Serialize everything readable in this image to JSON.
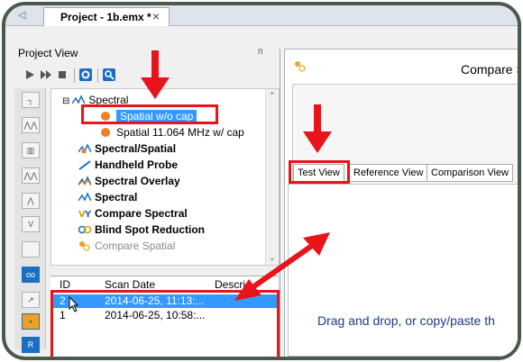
{
  "document_tab": {
    "scroll_glyph": "◁",
    "label": "Project - 1b.emx *",
    "close_glyph": "×"
  },
  "project_view": {
    "title": "Project View",
    "pin_glyph": "ᴨ",
    "toolbar": [
      "play-icon",
      "fast-forward-icon",
      "stop-icon",
      "settings-icon",
      "search-icon"
    ],
    "left_rail_icons": [
      "spectral-icon",
      "spectral-icon",
      "bars-icon",
      "spectral-icon",
      "spectral-icon",
      "compare-icon",
      "blank-icon",
      "blind-spot-icon",
      "probe-icon",
      "overlay-icon",
      "app-icon"
    ],
    "tree": [
      {
        "label": "Spectral",
        "level": 1,
        "icon": "spectral-icon",
        "expanded": true
      },
      {
        "label": "Spatial w/o cap",
        "level": 2,
        "icon": "spatial-dot-icon",
        "selected": true
      },
      {
        "label": "Spatial 11.064 MHz w/ cap",
        "level": 2,
        "icon": "spatial-dot-icon"
      },
      {
        "label": "Spectral/Spatial",
        "level": 1,
        "icon": "spectral-spatial-icon"
      },
      {
        "label": "Handheld Probe",
        "level": 1,
        "icon": "probe-icon"
      },
      {
        "label": "Spectral Overlay",
        "level": 1,
        "icon": "overlay-icon"
      },
      {
        "label": "Spectral",
        "level": 1,
        "icon": "spectral-icon"
      },
      {
        "label": "Compare Spectral",
        "level": 1,
        "icon": "compare-spectral-icon"
      },
      {
        "label": "Blind Spot Reduction",
        "level": 1,
        "icon": "blind-spot-icon"
      },
      {
        "label": "Compare Spatial",
        "level": 1,
        "icon": "compare-spatial-icon",
        "disabled": true
      }
    ],
    "grid": {
      "columns": [
        "ID",
        "Scan Date",
        "Descri"
      ],
      "rows": [
        {
          "id": "2",
          "date": "2014-06-25,  11:13:...",
          "desc": "",
          "selected": true
        },
        {
          "id": "1",
          "date": "2014-06-25,  10:58:...",
          "desc": "",
          "selected": false
        }
      ]
    }
  },
  "compare_panel": {
    "title": "Compare S",
    "tabs": [
      "Test View",
      "Reference View",
      "Comparison View"
    ],
    "active_tab": "Test View",
    "drag_text": "Drag and drop, or copy/paste th"
  },
  "colors": {
    "highlight": "#e8141c",
    "selection": "#3399ff",
    "frame": "#4a5a4a",
    "drag_text": "#1a3a8c"
  }
}
